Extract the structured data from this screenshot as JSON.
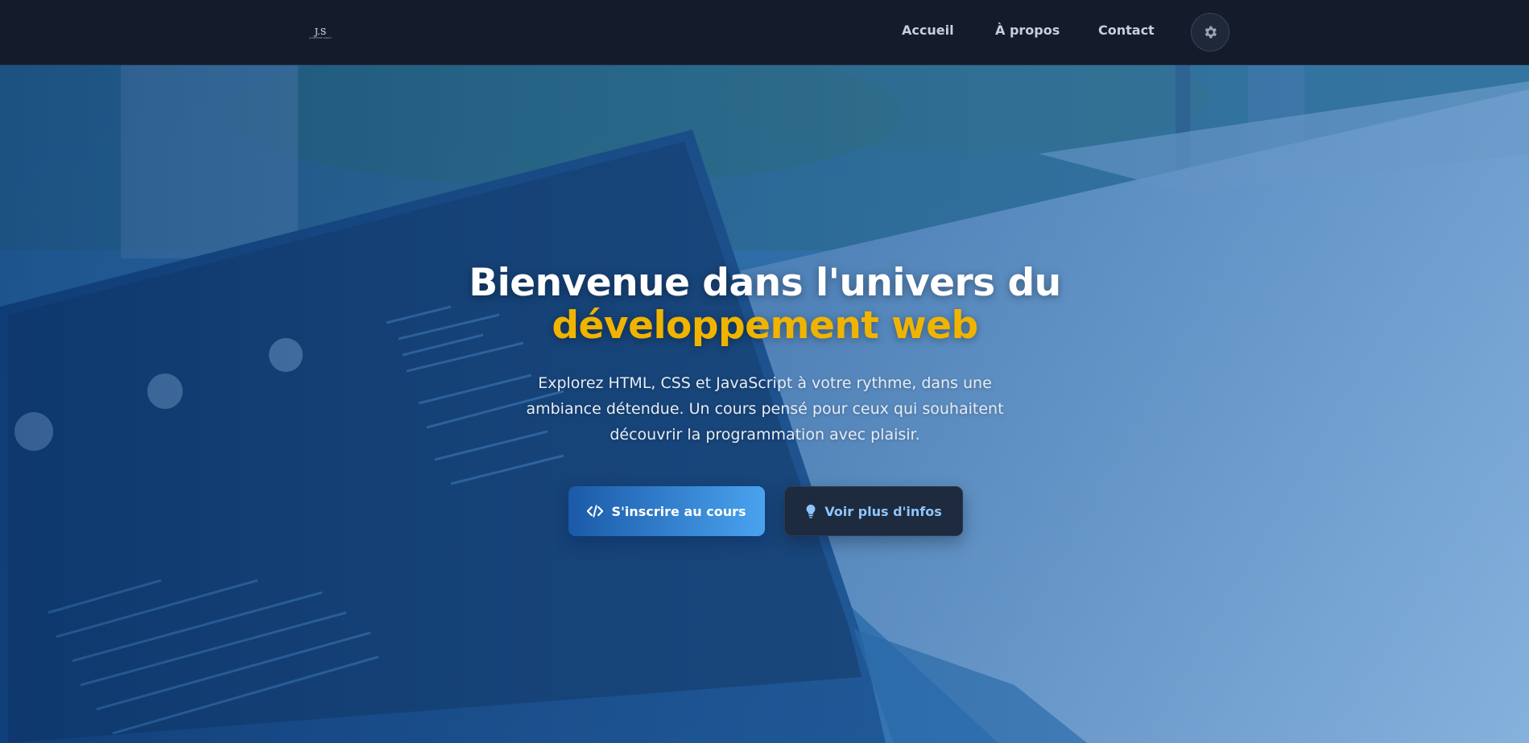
{
  "header": {
    "logo_text": "J.S",
    "logo_subtext": "JOSEPHINE SARAH",
    "nav": [
      {
        "label": "Accueil"
      },
      {
        "label": "À propos"
      },
      {
        "label": "Contact"
      }
    ],
    "theme_toggle_icon": "gear-icon"
  },
  "hero": {
    "title_line1": "Bienvenue dans l'univers du",
    "title_line2": "développement web",
    "description": "Explorez HTML, CSS et JavaScript à votre rythme, dans une ambiance détendue. Un cours pensé pour ceux qui souhaitent découvrir la programmation avec plaisir.",
    "primary_button": {
      "label": "S'inscrire au cours",
      "icon": "code-icon"
    },
    "secondary_button": {
      "label": "Voir plus d'infos",
      "icon": "lightbulb-icon"
    }
  },
  "colors": {
    "accent": "#f0b400",
    "primary": "#3a8fe0",
    "navbar": "#141c2c"
  }
}
